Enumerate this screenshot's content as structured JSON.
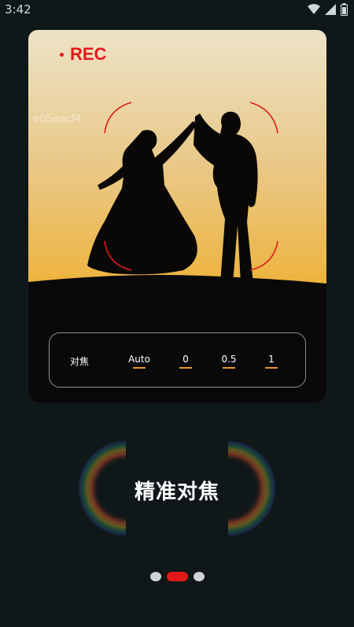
{
  "status_bar": {
    "time": "3:42",
    "icons": [
      "wifi-icon",
      "cellular-signal-icon",
      "battery-icon"
    ]
  },
  "preview": {
    "rec_label": "REC",
    "watermark": "e05eacf4",
    "focus_panel": {
      "label": "对焦",
      "options": [
        "Auto",
        "0",
        "0.5",
        "1"
      ]
    }
  },
  "feature_title": "精准对焦",
  "pager": {
    "count": 3,
    "active_index": 1
  },
  "colors": {
    "accent_red": "#e21818",
    "focus_bracket": "#e01a1a",
    "option_underline": "#e7962a",
    "background": "#0f1719"
  }
}
